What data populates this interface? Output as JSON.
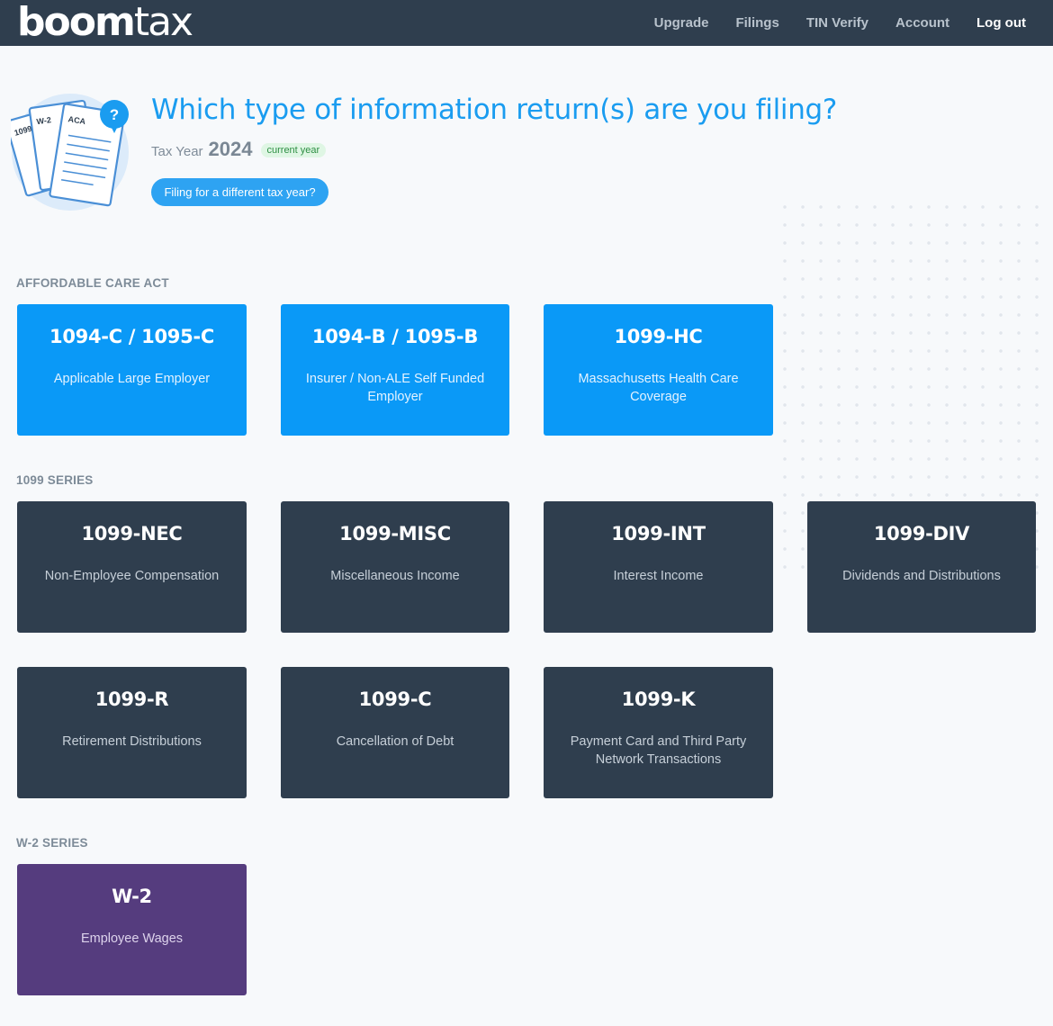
{
  "brand": {
    "logo_bold": "boom",
    "logo_light": "tax"
  },
  "nav": {
    "upgrade": "Upgrade",
    "filings": "Filings",
    "tin_verify": "TIN Verify",
    "account": "Account",
    "logout": "Log out"
  },
  "hero": {
    "headline": "Which type of information return(s) are you filing?",
    "tax_year_label": "Tax Year",
    "tax_year": "2024",
    "badge": "current year",
    "different_year_button": "Filing for a different tax year?",
    "icon_labels": {
      "f1099": "1099",
      "w2": "W-2",
      "aca": "ACA",
      "help": "?"
    }
  },
  "sections": {
    "aca": {
      "label": "AFFORDABLE CARE ACT",
      "cards": [
        {
          "title": "1094-C / 1095-C",
          "desc": "Applicable Large Employer"
        },
        {
          "title": "1094-B / 1095-B",
          "desc": "Insurer / Non-ALE Self Funded Employer"
        },
        {
          "title": "1099-HC",
          "desc": "Massachusetts Health Care Coverage"
        }
      ]
    },
    "s1099": {
      "label": "1099 SERIES",
      "cards": [
        {
          "title": "1099-NEC",
          "desc": "Non-Employee Compensation"
        },
        {
          "title": "1099-MISC",
          "desc": "Miscellaneous Income"
        },
        {
          "title": "1099-INT",
          "desc": "Interest Income"
        },
        {
          "title": "1099-DIV",
          "desc": "Dividends and Distributions"
        },
        {
          "title": "1099-R",
          "desc": "Retirement Distributions"
        },
        {
          "title": "1099-C",
          "desc": "Cancellation of Debt"
        },
        {
          "title": "1099-K",
          "desc": "Payment Card and Third Party Network Transactions"
        }
      ]
    },
    "w2": {
      "label": "W-2 SERIES",
      "cards": [
        {
          "title": "W-2",
          "desc": "Employee Wages"
        }
      ]
    }
  },
  "colors": {
    "navbar": "#2f3e4e",
    "aca_card": "#0a99f7",
    "series_1099_card": "#2f3e4e",
    "w2_card": "#553c7e",
    "headline": "#1a9cf0"
  }
}
